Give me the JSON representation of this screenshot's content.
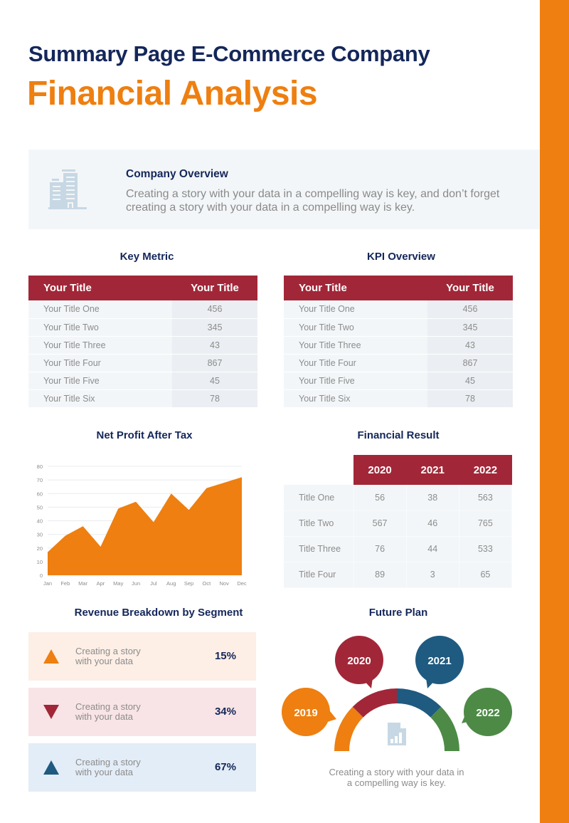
{
  "header": {
    "subtitle": "Summary Page E-Commerce Company",
    "title": "Financial Analysis"
  },
  "colors": {
    "accent_orange": "#ee7f10",
    "navy": "#14275a",
    "crimson": "#a12738",
    "blue": "#1f5a80",
    "green": "#4d8a46"
  },
  "overview": {
    "icon": "building-icon",
    "title": "Company Overview",
    "text": "Creating a story with your data in a compelling way is key, and don’t forget creating a story with your data in a compelling way is key."
  },
  "key_metric": {
    "title": "Key Metric",
    "headers": [
      "Your Title",
      "Your Title"
    ],
    "rows": [
      [
        "Your Title One",
        "456"
      ],
      [
        "Your Title Two",
        "345"
      ],
      [
        "Your Title Three",
        "43"
      ],
      [
        "Your Title Four",
        "867"
      ],
      [
        "Your Title Five",
        "45"
      ],
      [
        "Your Title Six",
        "78"
      ]
    ]
  },
  "kpi_overview": {
    "title": "KPI Overview",
    "headers": [
      "Your Title",
      "Your Title"
    ],
    "rows": [
      [
        "Your Title One",
        "456"
      ],
      [
        "Your Title Two",
        "345"
      ],
      [
        "Your Title Three",
        "43"
      ],
      [
        "Your Title Four",
        "867"
      ],
      [
        "Your Title Five",
        "45"
      ],
      [
        "Your Title Six",
        "78"
      ]
    ]
  },
  "chart_data": {
    "type": "area",
    "title": "Net Profit After Tax",
    "xlabel": "",
    "ylabel": "",
    "categories": [
      "Jan",
      "Feb",
      "Mar",
      "Apr",
      "May",
      "Jun",
      "Jul",
      "Aug",
      "Sep",
      "Oct",
      "Nov",
      "Dec"
    ],
    "values": [
      17,
      29,
      36,
      21,
      49,
      54,
      39,
      60,
      48,
      64,
      68,
      72
    ],
    "ylim": [
      0,
      80
    ],
    "yticks": [
      0,
      10,
      20,
      30,
      40,
      50,
      60,
      70,
      80
    ],
    "grid": true,
    "legend": "none",
    "color": "#ee7f10"
  },
  "financial_result": {
    "title": "Financial Result",
    "years": [
      "2020",
      "2021",
      "2022"
    ],
    "rows": [
      {
        "label": "Title One",
        "values": [
          "56",
          "38",
          "563"
        ]
      },
      {
        "label": "Title Two",
        "values": [
          "567",
          "46",
          "765"
        ]
      },
      {
        "label": "Title Three",
        "values": [
          "76",
          "44",
          "533"
        ]
      },
      {
        "label": "Title Four",
        "values": [
          "89",
          "3",
          "65"
        ]
      }
    ]
  },
  "revenue_breakdown": {
    "title": "Revenue Breakdown by Segment",
    "items": [
      {
        "icon": "triangle-up-icon",
        "text_line1": "Creating a story",
        "text_line2": "with your data",
        "value": "15%",
        "color": "#ee7f10",
        "bg": "#fdefe6"
      },
      {
        "icon": "triangle-down-icon",
        "text_line1": "Creating a story",
        "text_line2": "with your data",
        "value": "34%",
        "color": "#a12738",
        "bg": "#f8e4e6"
      },
      {
        "icon": "triangle-up-icon",
        "text_line1": "Creating a story",
        "text_line2": "with your data",
        "value": "67%",
        "color": "#1f5a80",
        "bg": "#e3edf7"
      }
    ]
  },
  "future_plan": {
    "title": "Future Plan",
    "milestones": [
      {
        "year": "2019",
        "color": "#ee7f10"
      },
      {
        "year": "2020",
        "color": "#a12738"
      },
      {
        "year": "2021",
        "color": "#1f5a80"
      },
      {
        "year": "2022",
        "color": "#4d8a46"
      }
    ],
    "center_icon": "report-chart-icon",
    "caption_line1": "Creating a story with your data in",
    "caption_line2": "a compelling way is key."
  }
}
